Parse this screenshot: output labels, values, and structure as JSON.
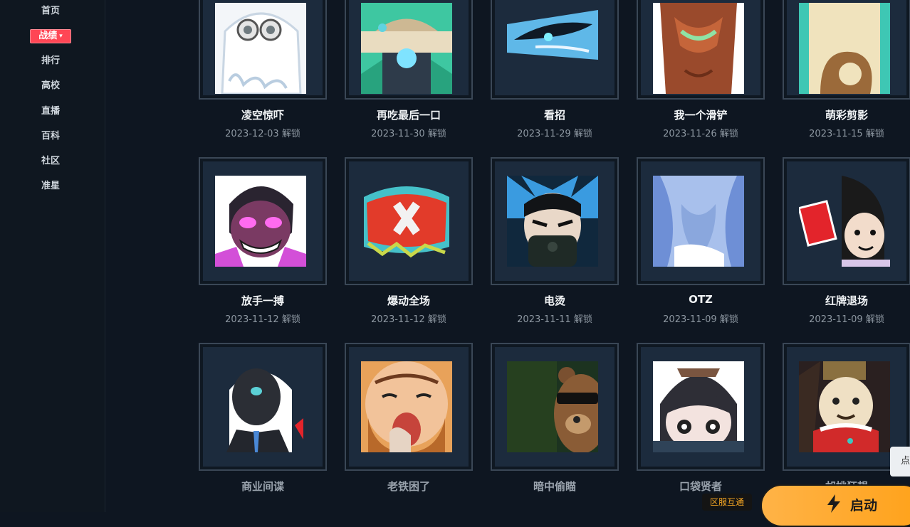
{
  "nav": {
    "items": [
      "首页",
      "战绩",
      "排行",
      "高校",
      "直播",
      "百科",
      "社区",
      "准星"
    ],
    "active": "战绩"
  },
  "sprays": [
    {
      "name": "凌空惊吓",
      "date": "2023-12-03 解锁",
      "icon": "ghost-spray-icon"
    },
    {
      "name": "再吃最后一口",
      "date": "2023-11-30 解锁",
      "icon": "food-spray-icon"
    },
    {
      "name": "看招",
      "date": "2023-11-29 解锁",
      "icon": "knife-spray-icon"
    },
    {
      "name": "我一个滑铲",
      "date": "2023-11-26 解锁",
      "icon": "dragon-spray-icon"
    },
    {
      "name": "萌彩剪影",
      "date": "2023-11-15 解锁",
      "icon": "silhouette-spray-icon"
    },
    {
      "name": "放手一搏",
      "date": "2023-11-12 解锁",
      "icon": "grin-spray-icon"
    },
    {
      "name": "爆动全场",
      "date": "2023-11-12 解锁",
      "icon": "graffiti-spray-icon"
    },
    {
      "name": "电烫",
      "date": "2023-11-11 解锁",
      "icon": "masked-agent-spray-icon"
    },
    {
      "name": "OTZ",
      "date": "2023-11-09 解锁",
      "icon": "bow-spray-icon"
    },
    {
      "name": "红牌退场",
      "date": "2023-11-09 解锁",
      "icon": "red-card-spray-icon"
    },
    {
      "name": "商业间谍",
      "date": "",
      "icon": "spy-spray-icon"
    },
    {
      "name": "老铁困了",
      "date": "",
      "icon": "yawn-spray-icon"
    },
    {
      "name": "暗中偷瞄",
      "date": "",
      "icon": "bear-spray-icon"
    },
    {
      "name": "口袋贤者",
      "date": "",
      "icon": "pocket-sage-spray-icon"
    },
    {
      "name": "胡桃狂想",
      "date": "",
      "icon": "nutcracker-spray-icon"
    }
  ],
  "region_badge": "区服互通",
  "launch_button": "启动",
  "side_tab": "点",
  "colors": {
    "accent": "#ff4655",
    "launch": "#ffa21a",
    "background": "#0e1621"
  }
}
